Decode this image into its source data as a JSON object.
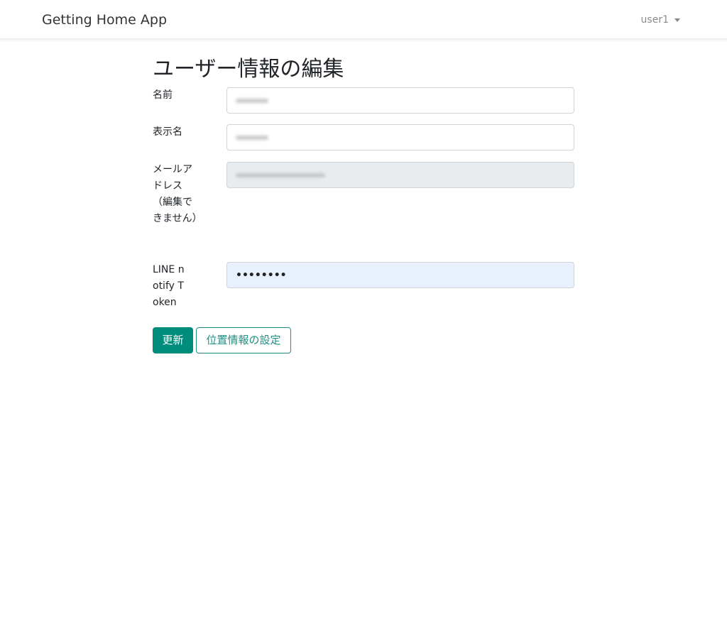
{
  "navbar": {
    "brand": "Getting Home App",
    "user": "user1"
  },
  "form": {
    "title": "ユーザー情報の編集",
    "fields": [
      {
        "label": "名前",
        "value": ""
      },
      {
        "label": "表示名",
        "value": ""
      },
      {
        "label": "メールアドレス（編集できません）",
        "value": ""
      },
      {
        "label": "LINE notify Token",
        "value": "••••••••"
      }
    ]
  },
  "buttons": {
    "update": "更新",
    "location": "位置情報の設定"
  },
  "colors": {
    "primary": "#008c7a",
    "outline": "#1e8f80",
    "disabled_bg": "#e9ecef",
    "autofill_bg": "#e8f0fe"
  },
  "icons": {
    "user_menu": "caret-down-icon"
  }
}
